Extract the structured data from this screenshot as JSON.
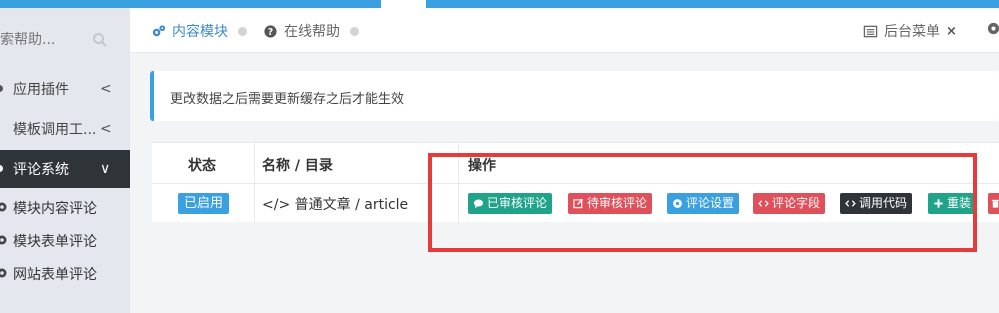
{
  "search": {
    "placeholder": "索帮助..."
  },
  "sidebar": {
    "items": [
      {
        "label": "应用插件",
        "chevron": "<"
      },
      {
        "label": "模板调用工...",
        "chevron": "<"
      },
      {
        "label": "评论系统",
        "chevron": "∨"
      }
    ],
    "sub_items": [
      {
        "label": "模块内容评论"
      },
      {
        "label": "模块表单评论"
      },
      {
        "label": "网站表单评论"
      }
    ]
  },
  "tabs": {
    "content": "内容模块",
    "help": "在线帮助",
    "backend": "后台菜单",
    "close": "×"
  },
  "alert": {
    "text": "更改数据之后需要更新缓存之后才能生效"
  },
  "table": {
    "headers": {
      "status": "状态",
      "name": "名称 / 目录",
      "actions": "操作"
    },
    "row": {
      "status": "已启用",
      "name": "</> 普通文章 / article",
      "buttons": {
        "approved": "已审核评论",
        "pending": "待审核评论",
        "settings": "评论设置",
        "fields": "评论字段",
        "code": "调用代码",
        "reinstall": "重装"
      }
    }
  },
  "colors": {
    "accent": "#3aa0e0",
    "green": "#1fa48a",
    "red": "#e0505a",
    "dark": "#2f3439",
    "annotation": "#e53b3b"
  }
}
